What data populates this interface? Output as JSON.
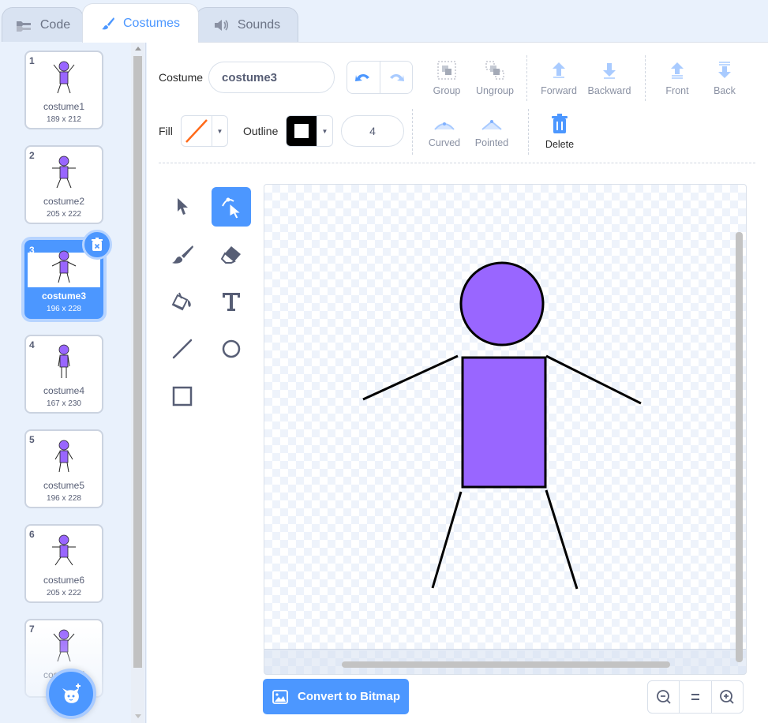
{
  "tabs": {
    "code": "Code",
    "costumes": "Costumes",
    "sounds": "Sounds"
  },
  "costumes": [
    {
      "num": "1",
      "name": "costume1",
      "size": "189 x 212"
    },
    {
      "num": "2",
      "name": "costume2",
      "size": "205 x 222"
    },
    {
      "num": "3",
      "name": "costume3",
      "size": "196 x 228"
    },
    {
      "num": "4",
      "name": "costume4",
      "size": "167 x 230"
    },
    {
      "num": "5",
      "name": "costume5",
      "size": "196 x 228"
    },
    {
      "num": "6",
      "name": "costume6",
      "size": "205 x 222"
    },
    {
      "num": "7",
      "name": "costume7",
      "size": ""
    }
  ],
  "toolbar": {
    "costume_label": "Costume",
    "costume_name": "costume3",
    "group": "Group",
    "ungroup": "Ungroup",
    "forward": "Forward",
    "backward": "Backward",
    "front": "Front",
    "back": "Back",
    "fill_label": "Fill",
    "outline_label": "Outline",
    "outline_width": "4",
    "curved": "Curved",
    "pointed": "Pointed",
    "delete": "Delete"
  },
  "colors": {
    "accent": "#4c97ff",
    "figure_fill": "#9966ff",
    "outline": "#000000"
  },
  "bottom": {
    "convert_bitmap": "Convert to Bitmap"
  }
}
